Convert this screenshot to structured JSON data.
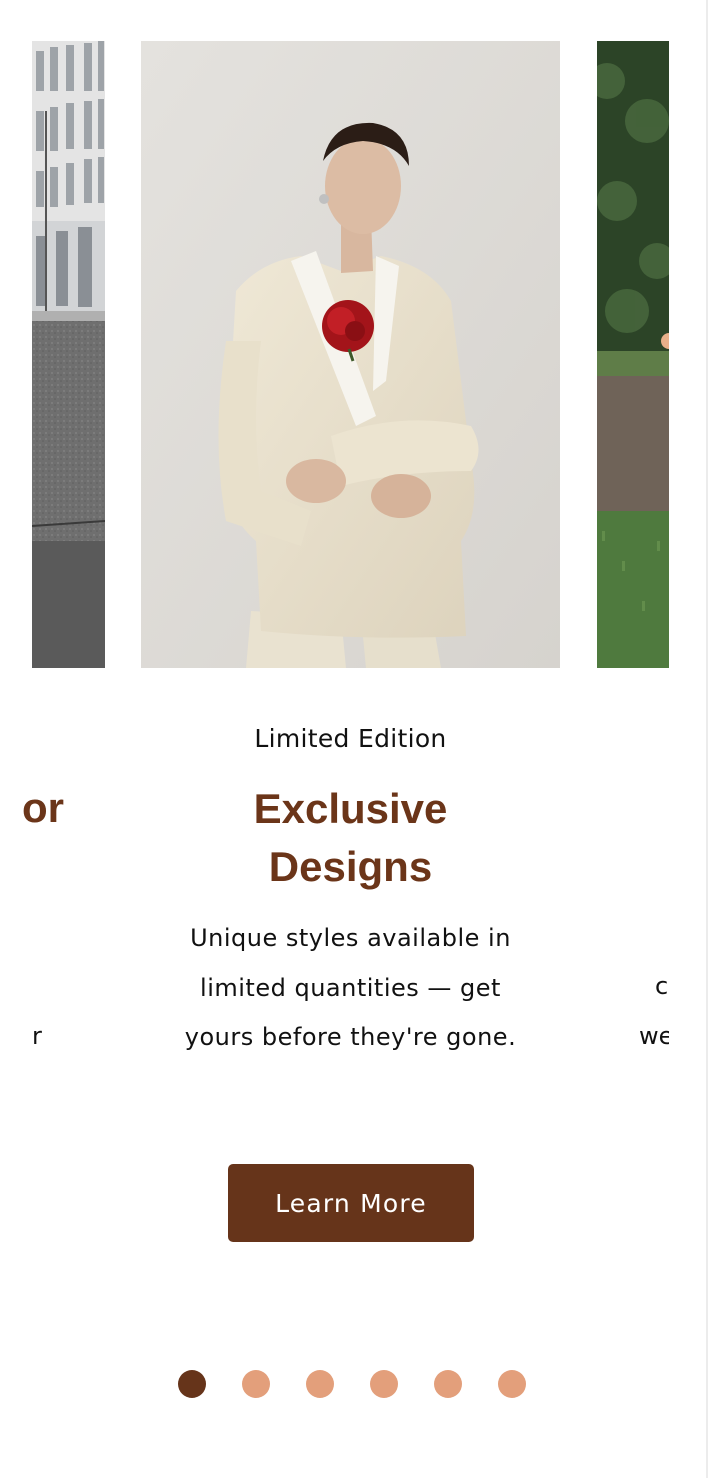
{
  "carousel": {
    "active_slide": {
      "eyebrow": "Limited Edition",
      "headline": "Exclusive Designs",
      "description": "Unique styles available in limited quantities — get yours before they're gone.",
      "cta_label": "Learn More"
    },
    "prev_slide_peek": {
      "headline_fragment": "or",
      "text_fragment": "r"
    },
    "next_slide_peek": {
      "text_fragment_line1": "c",
      "text_fragment_line2": "we"
    },
    "pagination": {
      "total": 6,
      "active_index": 0
    }
  },
  "colors": {
    "brand_brown": "#66341a",
    "headline_brown": "#6b3519",
    "dot_inactive": "#e39f7b",
    "background": "#ffffff"
  }
}
